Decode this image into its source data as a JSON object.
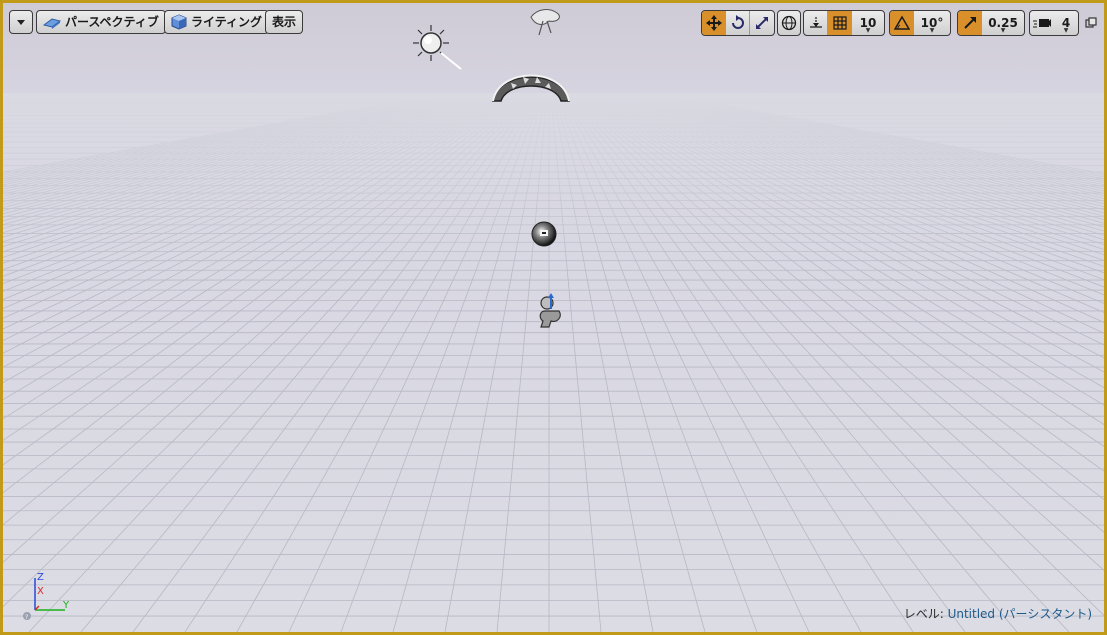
{
  "toolbar_left": {
    "perspective_label": "パースペクティブ",
    "lighting_label": "ライティング",
    "show_label": "表示"
  },
  "toolbar_right": {
    "grid_snap_value": "10",
    "rotation_snap_value": "10°",
    "scale_snap_value": "0.25",
    "camera_speed_value": "4"
  },
  "axis": {
    "z_label": "Z",
    "x_label": "X",
    "y_label": "Y"
  },
  "status": {
    "level_prefix": "レベル:",
    "level_name": "Untitled",
    "level_suffix": "(パーシスタント)"
  },
  "colors": {
    "viewport_border": "#c29a1a",
    "active_tool": "#d9902a",
    "level_name": "#1d5a8a"
  }
}
